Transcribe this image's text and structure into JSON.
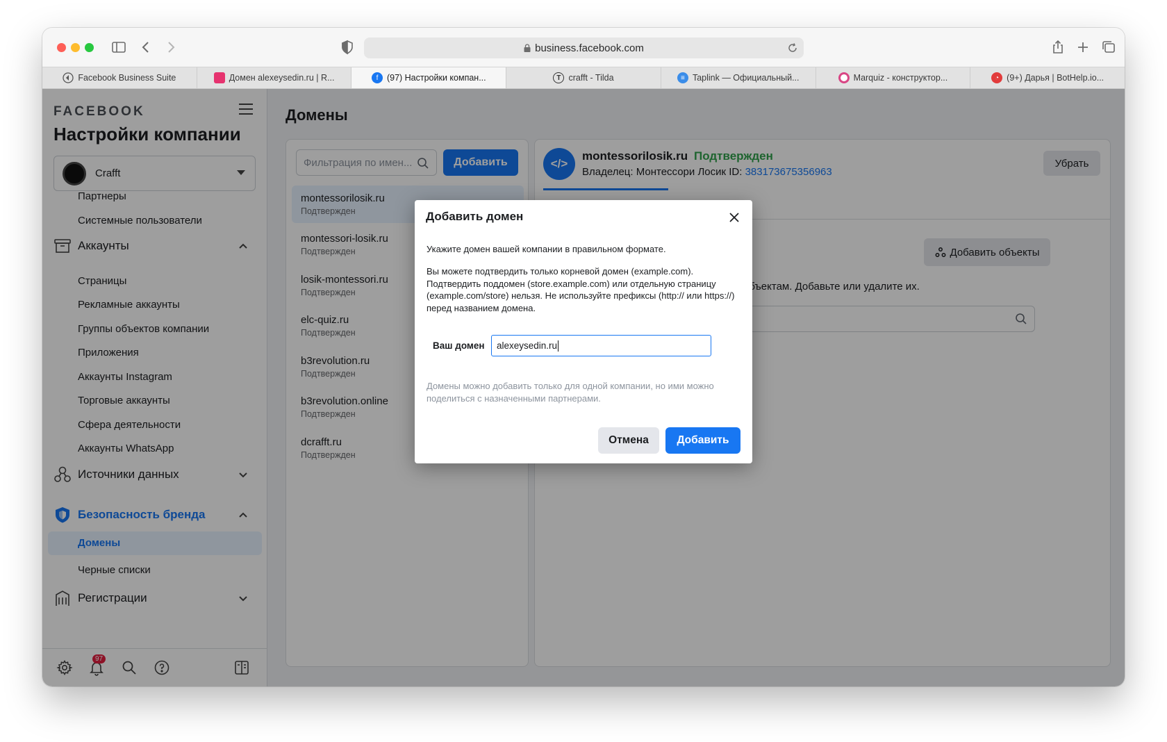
{
  "browser": {
    "url": "business.facebook.com",
    "tabs": [
      {
        "label": "Facebook Business Suite",
        "favicon": "fb-business-icon"
      },
      {
        "label": "Домен alexeysedin.ru | R...",
        "favicon": "folder-pink-icon"
      },
      {
        "label": "(97) Настройки компан...",
        "favicon": "facebook-icon"
      },
      {
        "label": "crafft - Tilda",
        "favicon": "tilda-icon"
      },
      {
        "label": "Taplink — Официальный...",
        "favicon": "taplink-icon"
      },
      {
        "label": "Marquiz - конструктор...",
        "favicon": "marquiz-icon"
      },
      {
        "label": "(9+) Дарья | BotHelp.io...",
        "favicon": "bothelp-icon"
      }
    ]
  },
  "sidebar": {
    "logo": "FACEBOOK",
    "title": "Настройки компании",
    "company": "Crafft",
    "items_top": [
      {
        "label": "Партнеры"
      },
      {
        "label": "Системные пользователи"
      }
    ],
    "section_accounts": "Аккаунты",
    "accounts_items": [
      {
        "label": "Страницы"
      },
      {
        "label": "Рекламные аккаунты"
      },
      {
        "label": "Группы объектов компании"
      },
      {
        "label": "Приложения"
      },
      {
        "label": "Аккаунты Instagram"
      },
      {
        "label": "Торговые аккаунты"
      },
      {
        "label": "Сфера деятельности"
      },
      {
        "label": "Аккаунты WhatsApp"
      }
    ],
    "section_data_sources": "Источники данных",
    "section_brand_safety": "Безопасность бренда",
    "brand_items": [
      {
        "label": "Домены"
      },
      {
        "label": "Черные списки"
      }
    ],
    "section_registrations": "Регистрации",
    "notification_count": "97"
  },
  "main": {
    "title": "Домены",
    "filter_placeholder": "Фильтрация по имен...",
    "add_button": "Добавить",
    "domains": [
      {
        "name": "montessorilosik.ru",
        "status": "Подтвержден"
      },
      {
        "name": "montessori-losik.ru",
        "status": "Подтвержден"
      },
      {
        "name": "losik-montessori.ru",
        "status": "Подтвержден"
      },
      {
        "name": "elc-quiz.ru",
        "status": "Подтвержден"
      },
      {
        "name": "b3revolution.ru",
        "status": "Подтвержден"
      },
      {
        "name": "b3revolution.online",
        "status": "Подтвержден"
      },
      {
        "name": "dcrafft.ru",
        "status": "Подтвержден"
      }
    ]
  },
  "detail": {
    "icon": "</>",
    "name": "montessorilosik.ru",
    "status": "Подтвержден",
    "owner_label": "Владелец: Монтессори Лосик  ID: ",
    "owner_id": "383173675356963",
    "remove_button": "Убрать",
    "add_objects_button": "Добавить объекты",
    "objects_text": "объектам. Добавьте или удалите их."
  },
  "modal": {
    "title": "Добавить домен",
    "intro": "Укажите домен вашей компании в правильном формате.",
    "rules": "Вы можете подтвердить только корневой домен (example.com). Подтвердить поддомен (store.example.com) или отдельную страницу (example.com/store) нельзя. Не используйте префиксы (http:// или https://) перед названием домена.",
    "field_label": "Ваш домен",
    "field_value": "alexeysedin.ru",
    "hint": "Домены можно добавить только для одной компании, но ими можно поделиться с назначенными партнерами.",
    "cancel": "Отмена",
    "submit": "Добавить"
  },
  "colors": {
    "accent": "#1877f2",
    "verified": "#31a24c",
    "overlay": "rgba(0,0,0,0.38)"
  }
}
